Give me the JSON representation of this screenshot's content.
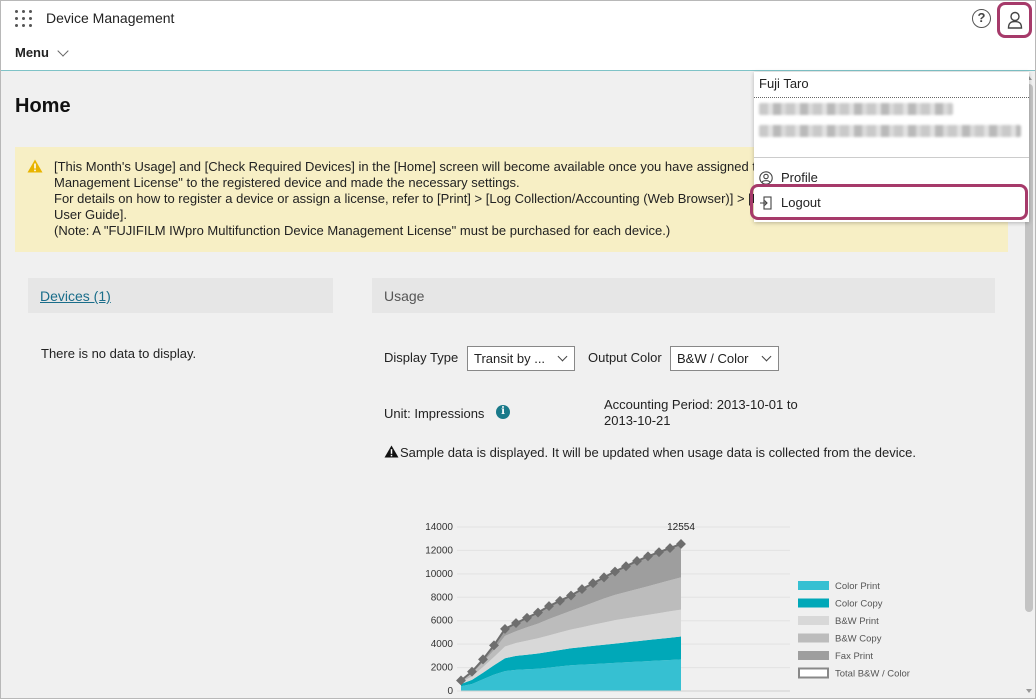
{
  "header": {
    "app_title": "Device Management",
    "menu_label": "Menu",
    "help_symbol": "?"
  },
  "page": {
    "title": "Home"
  },
  "banner": {
    "icon": "warning-icon",
    "lines": [
      "[This Month's Usage] and [Check Required Devices] in the [Home] screen will become available once you have assigned the",
      "Management License\" to the registered device and made the necessary settings.",
      "For details on how to register a device or assign a license, refer to [Print] > [Log Collection/Accounting (Web Browser)] > [R",
      "User Guide].",
      "(Note: A \"FUJIFILM IWpro Multifunction Device Management License\" must be purchased for each device.)"
    ]
  },
  "devices": {
    "link": "Devices (1)",
    "empty": "There is no data to display."
  },
  "usage": {
    "title": "Usage",
    "display_type_label": "Display Type",
    "display_type_value": "Transit by ...",
    "output_color_label": "Output Color",
    "output_color_value": "B&W / Color",
    "unit_label": "Unit: Impressions",
    "accounting_line1": "Accounting Period: 2013-10-01 to",
    "accounting_line2": "2013-10-21",
    "sample_note": "Sample data is displayed. It will be updated when usage data is collected from the device."
  },
  "user_menu": {
    "name": "Fuji Taro",
    "profile": "Profile",
    "logout": "Logout"
  },
  "chart_data": {
    "type": "area",
    "x": [
      1,
      2,
      3,
      4,
      5,
      6,
      7,
      8,
      9,
      10,
      11,
      12,
      13,
      14,
      15,
      16,
      17,
      18,
      19,
      20,
      21
    ],
    "ylim": [
      0,
      14000
    ],
    "yticks": [
      0,
      2000,
      4000,
      6000,
      8000,
      10000,
      12000,
      14000
    ],
    "series": [
      {
        "name": "Color Print",
        "color": "#36c0d2",
        "values": [
          400,
          600,
          1000,
          1400,
          1700,
          1800,
          1850,
          1900,
          2000,
          2100,
          2200,
          2250,
          2300,
          2350,
          2400,
          2450,
          2500,
          2550,
          2600,
          2650,
          2700
        ]
      },
      {
        "name": "Color Copy",
        "color": "#00a8b8",
        "values": [
          200,
          350,
          550,
          800,
          1100,
          1200,
          1250,
          1300,
          1350,
          1400,
          1450,
          1500,
          1550,
          1600,
          1650,
          1700,
          1750,
          1800,
          1850,
          1900,
          1950
        ]
      },
      {
        "name": "B&W Print",
        "color": "#d8d8d8",
        "values": [
          150,
          300,
          500,
          700,
          1000,
          1100,
          1200,
          1300,
          1400,
          1500,
          1600,
          1700,
          1800,
          1900,
          2000,
          2050,
          2100,
          2150,
          2200,
          2250,
          2300
        ]
      },
      {
        "name": "B&W Copy",
        "color": "#bcbcbc",
        "values": [
          100,
          250,
          400,
          600,
          900,
          1000,
          1150,
          1250,
          1400,
          1500,
          1600,
          1750,
          1900,
          2050,
          2150,
          2250,
          2350,
          2450,
          2550,
          2650,
          2750
        ]
      },
      {
        "name": "Fax Print",
        "color": "#9e9e9e",
        "values": [
          50,
          150,
          250,
          400,
          600,
          700,
          800,
          950,
          1100,
          1200,
          1300,
          1500,
          1650,
          1800,
          2000,
          2200,
          2400,
          2550,
          2650,
          2750,
          2854
        ]
      }
    ],
    "total_series": "Total B&W / Color",
    "total_label": "12554",
    "legend_position": "right"
  }
}
